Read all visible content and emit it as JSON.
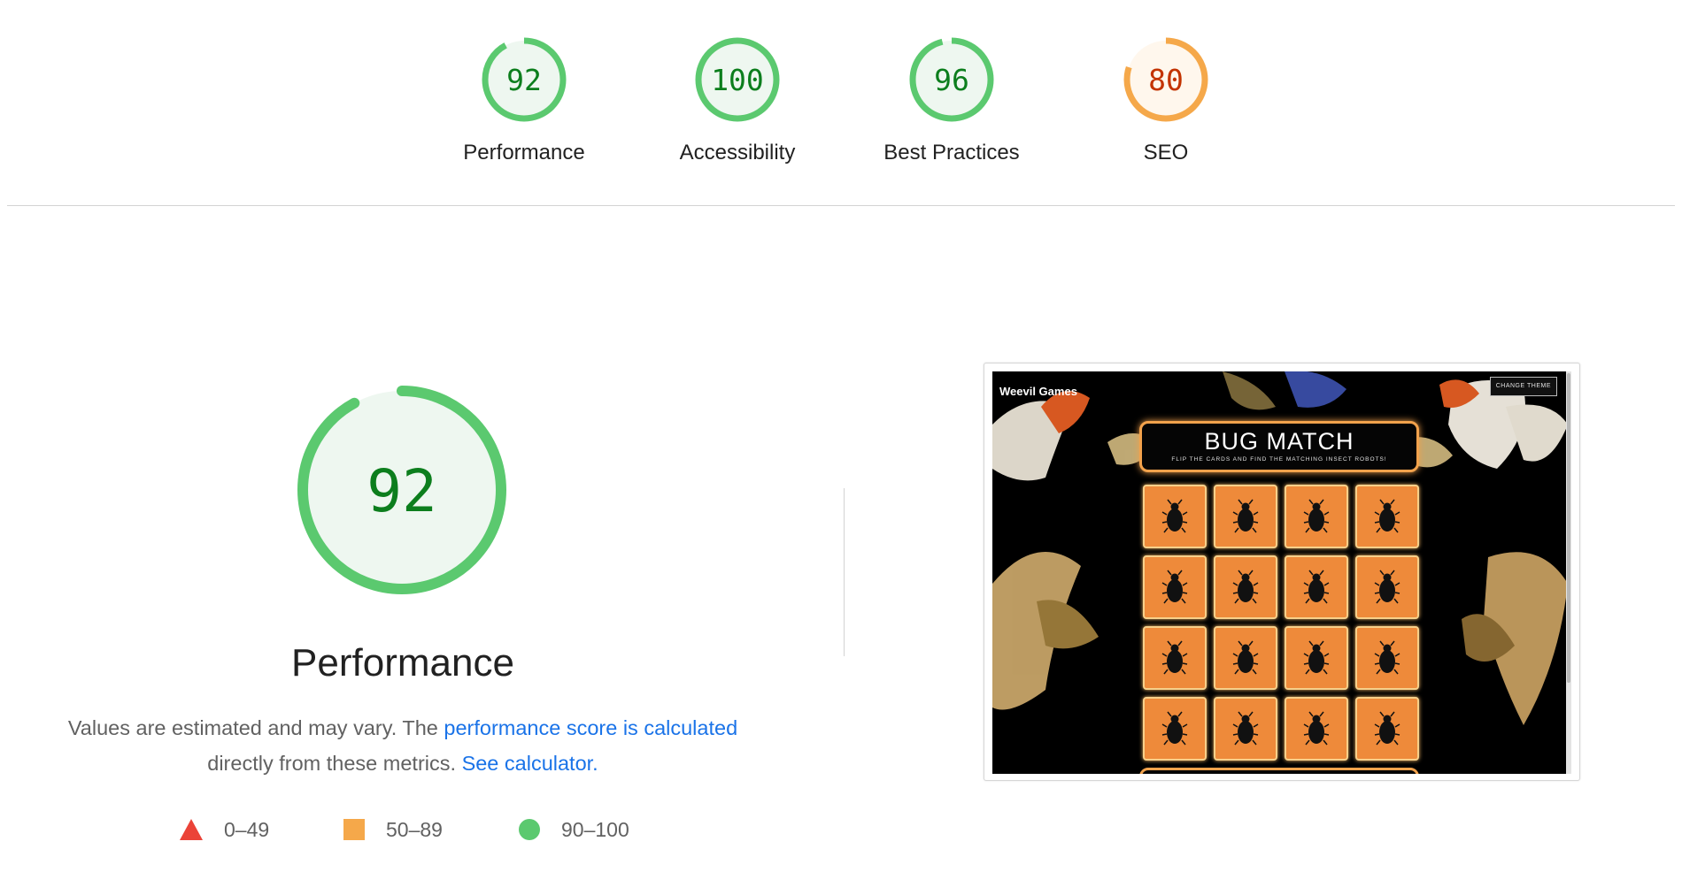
{
  "categories": [
    {
      "score": "92",
      "label": "Performance",
      "status": "pass",
      "fraction": 0.92
    },
    {
      "score": "100",
      "label": "Accessibility",
      "status": "pass",
      "fraction": 1.0
    },
    {
      "score": "96",
      "label": "Best Practices",
      "status": "pass",
      "fraction": 0.96
    },
    {
      "score": "80",
      "label": "SEO",
      "status": "average",
      "fraction": 0.8
    }
  ],
  "performance": {
    "score": "92",
    "fraction": 0.92,
    "title": "Performance",
    "description_prefix": "Values are estimated and may vary. The ",
    "score_link": "performance score is calculated",
    "description_middle": " directly from these metrics. ",
    "calculator_link": "See calculator."
  },
  "legend": [
    {
      "range": "0–49",
      "shape": "triangle",
      "color": "#eb4338"
    },
    {
      "range": "50–89",
      "shape": "square",
      "color": "#f5a84a"
    },
    {
      "range": "90–100",
      "shape": "circle",
      "color": "#5bc96f"
    }
  ],
  "screenshot": {
    "brand": "Weevil Games",
    "theme_button": "CHANGE THEME",
    "game_title": "BUG MATCH",
    "game_subtitle": "FLIP THE CARDS AND FIND THE MATCHING INSECT ROBOTS!",
    "card_count": 16
  },
  "colors": {
    "pass": "#0c7e1d",
    "pass_ring": "#5bc96f",
    "pass_fill": "#eef7f0",
    "average": "#c33300",
    "average_ring": "#f5a84a",
    "average_fill": "#fff7ed",
    "link": "#1a73e8"
  }
}
